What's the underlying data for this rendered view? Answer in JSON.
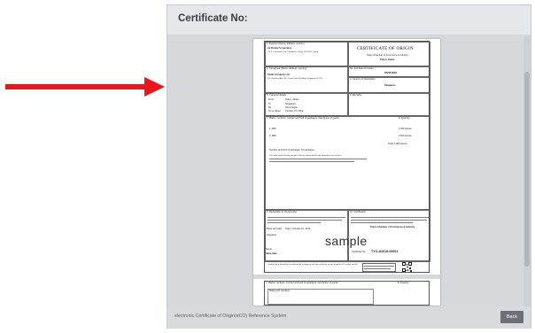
{
  "header": {
    "title": "Certificate No:"
  },
  "footer": {
    "system_name": "electronic Certificate of Origin(eCO) Reference System",
    "back_label": "Back"
  },
  "certificate": {
    "main_title": "CERTIFICATE OF ORIGIN",
    "issuer": "Tokyo Chamber of Commerce & Industry",
    "city": "Tokyo, Japan",
    "exporter_label": "1. Exporter (Name, address, country)",
    "exporter_name": "AJ Osaka Corporation",
    "exporter_address": "1-2-3, Uchisaiwai-cho, Chiyoda-ku, Tokyo 100-0011, Japan",
    "consignee_label": "2. Consignee (Name, address, country)",
    "consignee_name": "Smith Company Ltd.",
    "consignee_address": "4-5, Kannoori Ave, 98, Ocean Tower Building, Singapore 111 111",
    "no_copy_label": "No. and date of Invoice",
    "invoice_no": "INV2019001",
    "destination_label": "4. Country of Destination",
    "destination": "Singapore",
    "transport_label": "5. Transport details",
    "from_label": "From",
    "from_value": "Tokyo, Japan",
    "to_label": "To",
    "to_value": "Singapore",
    "vessel_label": "By",
    "vessel_value": "Sea Freight",
    "date_label": "On or about",
    "date_value": "October 15, 2019",
    "remarks_label": "6. Remarks",
    "goods_label": "7. Marks, numbers, number and kind of packages; description of goods",
    "quantity_label": "8. Quantity",
    "goods_item1": "1.  ABC",
    "goods_item2": "2.  ABC",
    "qty1": "1,000 pieces",
    "qty2": "2,000 pieces",
    "total_qty": "Total: 3,000 pieces",
    "packages_total": "Number and kind of packages: 10 packages",
    "declaration_text": "The undersigned hereby declares that the above details and statements are correct.",
    "declaration_label": "9. Declaration by the Exporter",
    "certification_label": "10. Certification",
    "certification_text": "The undersigned hereby certifies on the basis of relative invoice and other supporting documents that the above-mentioned goods originate in the country shown.",
    "certifier_name": "Tokyo Chamber of Commerce & Industry",
    "place_date_label": "Place and date",
    "place_date_value": "Tokyo, October 10, 2019",
    "signature_label": "Signature",
    "watermark": "sample",
    "name_label": "Name",
    "name_value": "Akira Sato",
    "cert_no_label": "Certificate No.",
    "cert_no_value": "TYO-A2019-00001",
    "verify_text": "Confirm the authenticity of certificate by comparing with this certificate on the original eCO system at URL.",
    "page2_label": "7. Marks, numbers, number and kind of packages; description of goods",
    "page2_qty_label": "8. Quantity",
    "page2_subtext": "Marks and numbers"
  }
}
